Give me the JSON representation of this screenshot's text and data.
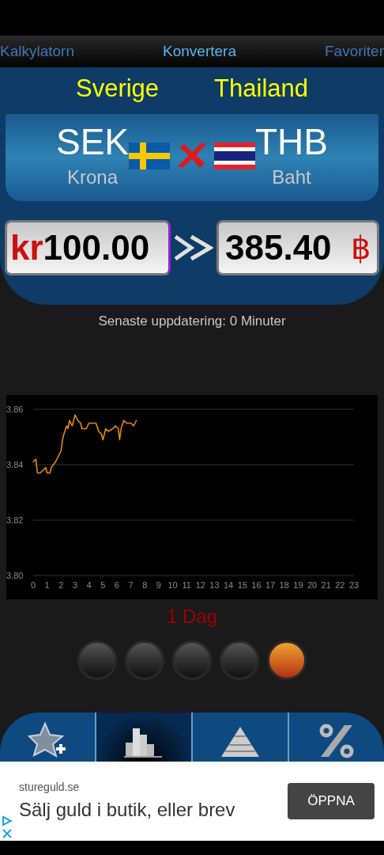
{
  "tabs": [
    {
      "label": "Kalkylatorn",
      "selected": false
    },
    {
      "label": "Konvertera",
      "selected": true
    },
    {
      "label": "Favoriter",
      "selected": false
    }
  ],
  "countries": {
    "from": "Sverige",
    "to": "Thailand"
  },
  "pair": {
    "from_code": "SEK",
    "from_name": "Krona",
    "to_code": "THB",
    "to_name": "Baht"
  },
  "amount": {
    "symbol": "kr",
    "value": "100.00"
  },
  "result": {
    "value": "385.40",
    "symbol": "฿"
  },
  "last_update": "Senaste uppdatering: 0 Minuter",
  "chart": {
    "chart_data": {
      "type": "line",
      "xlim": [
        0,
        23
      ],
      "ylim": [
        3.8,
        3.86
      ],
      "xticks": [
        0,
        1,
        2,
        3,
        4,
        5,
        6,
        7,
        8,
        9,
        10,
        11,
        12,
        13,
        14,
        15,
        16,
        17,
        18,
        19,
        20,
        21,
        22,
        23
      ],
      "yticks": [
        {
          "value": 3.8,
          "label": "3.80"
        },
        {
          "value": 3.82,
          "label": "3.82"
        },
        {
          "value": 3.84,
          "label": "3.84"
        },
        {
          "value": 3.86,
          "label": "3.86"
        }
      ],
      "x": [
        0,
        0.2,
        0.3,
        0.5,
        0.7,
        0.9,
        1.0,
        1.2,
        1.3,
        1.6,
        1.8,
        2.0,
        2.1,
        2.2,
        2.4,
        2.5,
        2.6,
        2.8,
        3.0,
        3.2,
        3.4,
        3.5,
        3.8,
        4.0,
        4.2,
        4.5,
        4.7,
        4.9,
        5.0,
        5.2,
        5.4,
        5.7,
        5.9,
        6.1,
        6.2,
        6.3,
        6.5,
        6.7,
        7.0,
        7.2,
        7.4
      ],
      "series": [
        {
          "color": "#e38a12",
          "values": [
            3.841,
            3.842,
            3.837,
            3.837,
            3.838,
            3.839,
            3.837,
            3.837,
            3.839,
            3.841,
            3.843,
            3.845,
            3.849,
            3.851,
            3.854,
            3.853,
            3.856,
            3.854,
            3.858,
            3.856,
            3.855,
            3.853,
            3.853,
            3.855,
            3.855,
            3.855,
            3.852,
            3.851,
            3.849,
            3.853,
            3.852,
            3.853,
            3.854,
            3.853,
            3.849,
            3.853,
            3.856,
            3.855,
            3.855,
            3.854,
            3.856
          ]
        }
      ]
    }
  },
  "period": "1 Dag",
  "periods": [
    {
      "selected": false
    },
    {
      "selected": false
    },
    {
      "selected": false
    },
    {
      "selected": false
    },
    {
      "selected": true
    }
  ],
  "toolbar": [
    {
      "kind": "favorite",
      "selected": false
    },
    {
      "kind": "chart",
      "selected": true
    },
    {
      "kind": "pyramid",
      "selected": false
    },
    {
      "kind": "percent",
      "selected": false
    }
  ],
  "ad": {
    "domain": "stureguld.se",
    "headline": "Sälj guld i butik, eller brev",
    "button": "ÖPPNA"
  }
}
